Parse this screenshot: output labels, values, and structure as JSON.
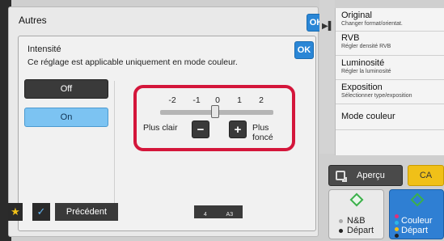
{
  "outer": {
    "title": "Autres",
    "ok_label": "OK"
  },
  "dialog": {
    "title": "Intensité",
    "description": "Ce réglage est applicable uniquement en mode couleur.",
    "ok_label": "OK",
    "options": [
      {
        "label": "Off",
        "selected": false
      },
      {
        "label": "On",
        "selected": true
      }
    ],
    "intensity": {
      "ticks": [
        "-2",
        "-1",
        "0",
        "1",
        "2"
      ],
      "value": 0,
      "label_lighter": "Plus clair",
      "label_darker": "Plus foncé",
      "minus_label": "−",
      "plus_label": "+",
      "highlight_color": "#d4163b"
    }
  },
  "menu": {
    "items": [
      {
        "label": "Original",
        "sub": "Changer format/orientat."
      },
      {
        "label": "RVB",
        "sub": "Régler densité RVB"
      },
      {
        "label": "Luminosité",
        "sub": "Régler la luminosité"
      },
      {
        "label": "Exposition",
        "sub": "Sélectionner type/exposition"
      },
      {
        "label": "Mode couleur",
        "sub": ""
      }
    ]
  },
  "actions": {
    "apercu_label": "Aperçu",
    "ca_label": "CA",
    "start_bw": {
      "line1": "N&B",
      "line2": "Départ"
    },
    "start_color": {
      "line1": "Couleur",
      "line2": "Départ"
    }
  },
  "bottom": {
    "prev_label": "Précédent",
    "paper_count": "4",
    "paper_size": "A3"
  },
  "colors": {
    "accent_blue": "#2a86d6",
    "selected_blue": "#7cc3f2",
    "ca_yellow": "#f0c018",
    "start_color_blue": "#2f7fd3",
    "start_green": "#3bb04a"
  }
}
